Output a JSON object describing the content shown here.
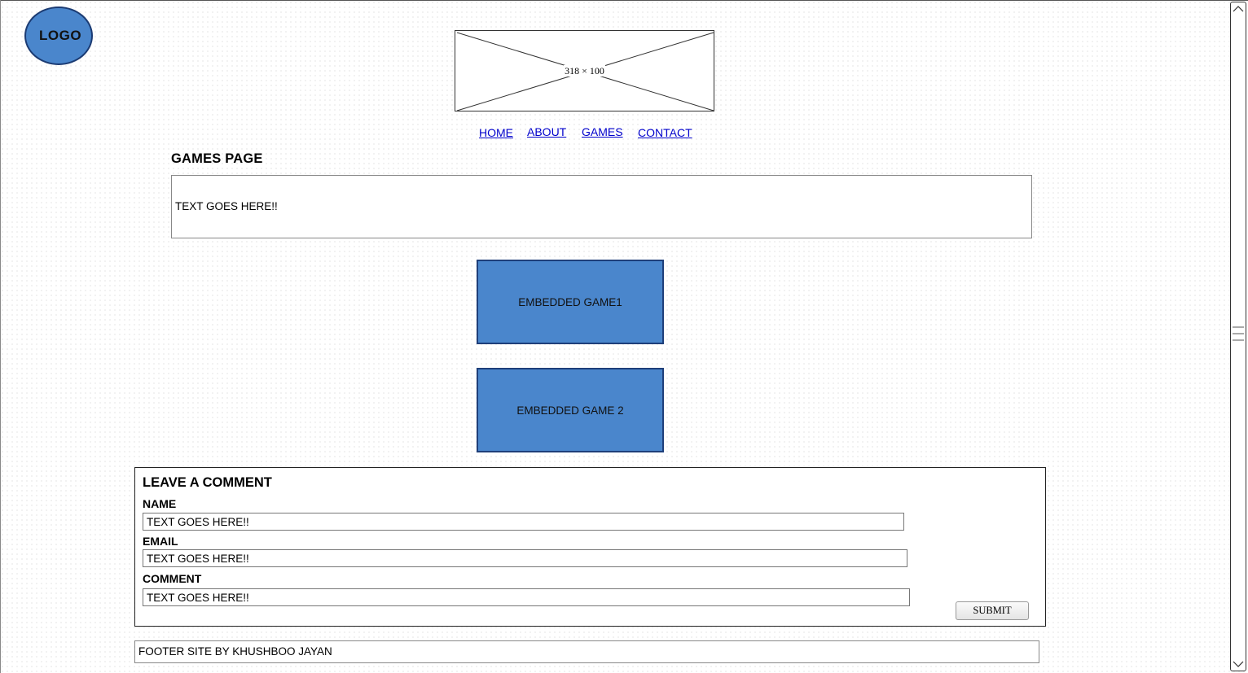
{
  "logo": {
    "text": "LOGO"
  },
  "header_image": {
    "dimensions_label": "318 × 100"
  },
  "nav": {
    "items": [
      {
        "label": "HOME"
      },
      {
        "label": "ABOUT"
      },
      {
        "label": "GAMES"
      },
      {
        "label": "CONTACT"
      }
    ]
  },
  "page": {
    "title": "GAMES PAGE",
    "intro_text": "TEXT GOES HERE!!"
  },
  "games": [
    {
      "label": "EMBEDDED GAME1"
    },
    {
      "label": "EMBEDDED GAME 2"
    }
  ],
  "comment_form": {
    "title": "LEAVE A COMMENT",
    "fields": [
      {
        "label": "NAME",
        "value": "TEXT GOES HERE!!"
      },
      {
        "label": "EMAIL",
        "value": "TEXT GOES HERE!!"
      },
      {
        "label": "COMMENT",
        "value": "TEXT GOES HERE!!"
      }
    ],
    "submit_label": "SUBMIT"
  },
  "footer": {
    "text": "FOOTER SITE BY KHUSHBOO JAYAN"
  },
  "colors": {
    "game_fill": "#4a86cc",
    "game_border": "#1f3f7a",
    "link": "#0000cc"
  },
  "icons": [
    "scroll-up-arrow-icon",
    "scroll-grip-icon",
    "scroll-down-arrow-icon"
  ]
}
